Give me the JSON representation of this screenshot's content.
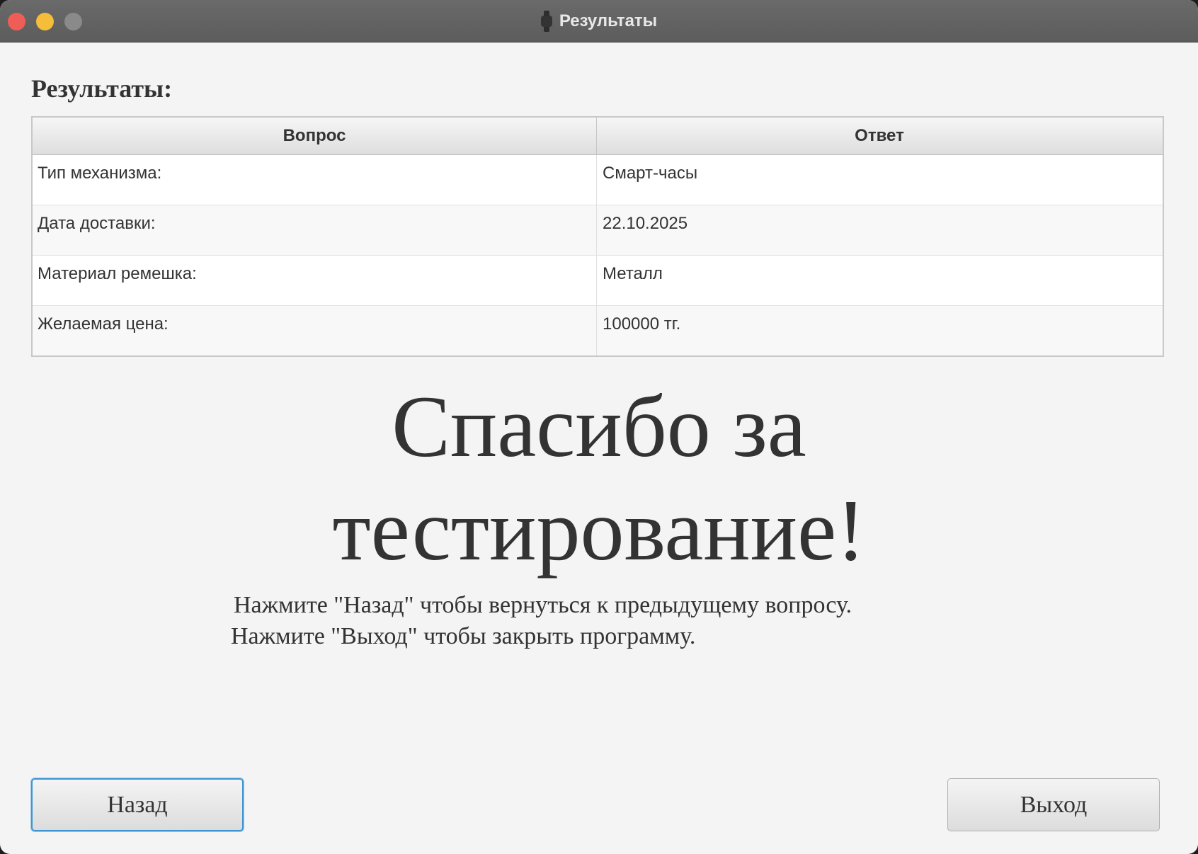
{
  "window": {
    "title": "Результаты",
    "icon": "smartwatch-icon"
  },
  "main": {
    "heading": "Результаты:",
    "table": {
      "headers": [
        "Вопрос",
        "Ответ"
      ],
      "rows": [
        [
          "Тип механизма:",
          "Смарт-часы"
        ],
        [
          "Дата доставки:",
          "22.10.2025"
        ],
        [
          "Материал ремешка:",
          "Металл"
        ],
        [
          "Желаемая цена:",
          "100000 тг."
        ]
      ]
    },
    "thanks_line1": "Спасибо за",
    "thanks_line2": "тестирование!",
    "hint_back": "Нажмите \"Назад\" чтобы вернуться к предыдущему вопросу.",
    "hint_exit": "Нажмите \"Выход\" чтобы закрыть программу."
  },
  "buttons": {
    "back_label": "Назад",
    "exit_label": "Выход"
  },
  "colors": {
    "focus_ring": "#3e95d3",
    "close": "#ee5e56",
    "minimize": "#f5bd3a",
    "maximize_disabled": "#8a8a8a"
  }
}
